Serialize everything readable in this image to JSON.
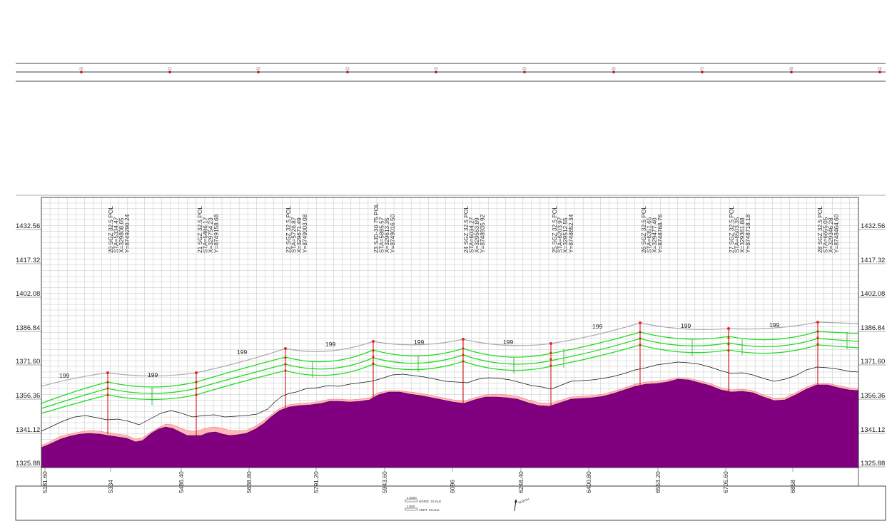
{
  "chart_data": {
    "type": "line",
    "elevation_labels": [
      "1432.56",
      "1417.32",
      "1402.08",
      "1386.84",
      "1371.60",
      "1356.36",
      "1341.12",
      "1325.88"
    ],
    "station_labels": [
      "5181.60",
      "5334",
      "5486.40",
      "5638.80",
      "5791.20",
      "5943.60",
      "6096",
      "6248.40",
      "6400.80",
      "6553.20",
      "6705.60",
      "6858"
    ],
    "plan_stations": [
      "20",
      "21",
      "22",
      "23",
      "24",
      "25",
      "26",
      "27",
      "28",
      "29"
    ],
    "connections": [
      {
        "line1": "20 SGZ 32.5 POL",
        "line2": "STA=5334.47",
        "line3": "X=329808.65",
        "line4": "Y=8749290.24"
      },
      {
        "line1": "21 SGZ 32.5 POL",
        "line2": "STA=5486.17",
        "line3": "X=329754.23",
        "line4": "Y=8749158.68"
      },
      {
        "line1": "22 SGZ 32.5 POL",
        "line2": "STA=5726.87",
        "line3": "X=329671.49",
        "line4": "Y=8749003.08"
      },
      {
        "line1": "23 SJD-30 75 POL",
        "line2": "STA=5885.57",
        "line3": "X=329613.35",
        "line4": "Y=8749016.50"
      },
      {
        "line1": "24 SGZ 32.5 POL",
        "line2": "STA=6034.27",
        "line3": "X=329563.89",
        "line4": "Y=8748935.92"
      },
      {
        "line1": "25 SGZ 32.5 POL",
        "line2": "STA=6203.97",
        "line3": "X=329512.55",
        "line4": "Y=8748852.34"
      },
      {
        "line1": "26 SGZ 32.5 POL",
        "line2": "STA=6351.65",
        "line3": "X=329477.40",
        "line4": "Y=8748768.76"
      },
      {
        "line1": "27 SGZ 32.5 POL",
        "line2": "STA=6503.35",
        "line3": "X=329361.88",
        "line4": "Y=8748718.18"
      },
      {
        "line1": "28 SGZ 32.5 POL",
        "line2": "STA=6655.05",
        "line3": "X=329346.28",
        "line4": "Y=8748464.60"
      }
    ],
    "span_labels": [
      "199",
      "199",
      "199",
      "199",
      "199",
      "199",
      "199",
      "199",
      "199"
    ],
    "series": [
      {
        "values": []
      }
    ],
    "ylim": [
      1325.88,
      1432.56
    ],
    "grid": true
  },
  "legend": {
    "horiz_scale": "HORIZ. SCALE",
    "vert_scale": "VERT. SCALE",
    "horiz_ratio": "1:2500",
    "vert_ratio": "1:500",
    "north": "NORTH"
  },
  "colors": {
    "terrain": "#800080",
    "conductor": "#22dd22",
    "pole": "#cc0000",
    "clearance": "#ff8888",
    "grid": "#b8b8b8"
  }
}
